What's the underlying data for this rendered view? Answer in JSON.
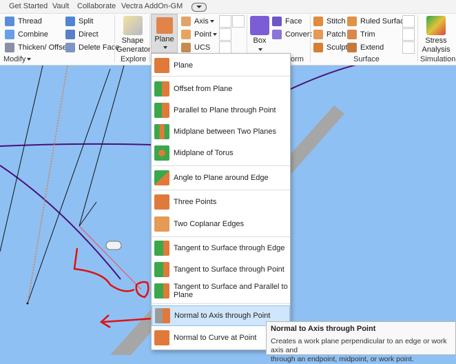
{
  "tabs": [
    "Get Started",
    "Vault",
    "Collaborate",
    "Vectra AddOn-GM"
  ],
  "modify": {
    "thread": "Thread",
    "combine": "Combine",
    "thicken": "Thicken/ Offset",
    "split": "Split",
    "direct": "Direct",
    "delete_face": "Delete Face",
    "panel": "Modify"
  },
  "explore": {
    "shape_generator_line1": "Shape",
    "shape_generator_line2": "Generator",
    "panel": "Explore"
  },
  "work_features": {
    "plane": "Plane",
    "axis": "Axis",
    "point": "Point",
    "ucs": "UCS"
  },
  "create": {
    "box": "Box",
    "face": "Face",
    "convert": "Convert",
    "panel_fragment": "orm"
  },
  "surface": {
    "stitch": "Stitch",
    "patch": "Patch",
    "sculpt": "Sculpt",
    "ruled_surface": "Ruled Surface",
    "trim": "Trim",
    "extend": "Extend",
    "panel": "Surface"
  },
  "simulation": {
    "stress_line1": "Stress",
    "stress_line2": "Analysis",
    "panel": "Simulation"
  },
  "plane_menu": {
    "items": [
      "Plane",
      "Offset from Plane",
      "Parallel to Plane through Point",
      "Midplane between Two Planes",
      "Midplane of Torus",
      "Angle to Plane around Edge",
      "Three Points",
      "Two Coplanar Edges",
      "Tangent to Surface through Edge",
      "Tangent to Surface through Point",
      "Tangent to Surface and Parallel to Plane",
      "Normal to Axis through Point",
      "Normal to Curve at Point"
    ],
    "highlighted_index": 11
  },
  "tooltip": {
    "title": "Normal to Axis through Point",
    "body_line1": "Creates a work plane perpendicular to an edge or work axis and",
    "body_line2": "through an endpoint, midpoint, or work point."
  },
  "colors": {
    "accent_orange": "#e07a3a",
    "accent_green": "#3aa84a",
    "highlight": "#cfe6fb",
    "viewport": "#8ec0f3"
  }
}
